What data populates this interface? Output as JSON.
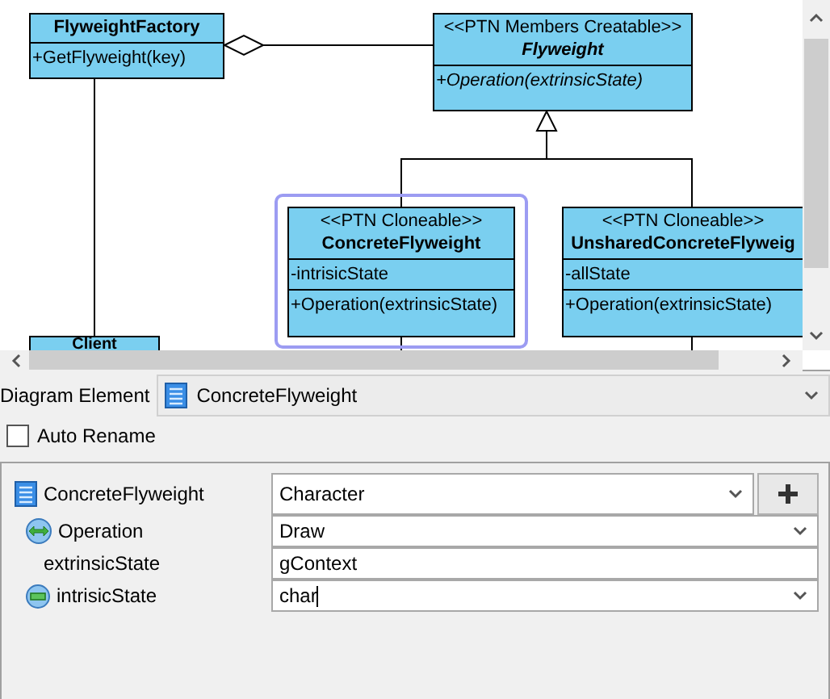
{
  "diagram": {
    "classes": [
      {
        "name": "FlyweightFactory",
        "abstract": false,
        "selected": false,
        "operations": [
          "+GetFlyweight(key)"
        ]
      },
      {
        "stereotype": "<<PTN Members Creatable>>",
        "name": "Flyweight",
        "abstract": true,
        "selected": false,
        "operations": [
          "+Operation(extrinsicState)"
        ]
      },
      {
        "stereotype": "<<PTN Cloneable>>",
        "name": "ConcreteFlyweight",
        "abstract": false,
        "selected": true,
        "attributes": [
          "-intrisicState"
        ],
        "operations": [
          "+Operation(extrinsicState)"
        ]
      },
      {
        "stereotype": "<<PTN Cloneable>>",
        "name": "UnsharedConcreteFlyweig",
        "abstract": false,
        "selected": false,
        "attributes": [
          "-allState"
        ],
        "operations": [
          "+Operation(extrinsicState)"
        ]
      },
      {
        "name": "Client",
        "abstract": false,
        "selected": false
      }
    ]
  },
  "element_selector": {
    "label": "Diagram Element",
    "value": "ConcreteFlyweight"
  },
  "auto_rename": {
    "label": "Auto Rename",
    "checked": false
  },
  "properties": [
    {
      "kind": "class",
      "name": "ConcreteFlyweight",
      "value": "Character",
      "dropdown": true,
      "add_button": true
    },
    {
      "kind": "operation",
      "name": "Operation",
      "value": "Draw",
      "dropdown": true
    },
    {
      "kind": "parameter",
      "name": "extrinsicState",
      "value": "gContext",
      "dropdown": false
    },
    {
      "kind": "attribute",
      "name": "intrisicState",
      "value": "char",
      "dropdown": true,
      "focused": true
    }
  ]
}
